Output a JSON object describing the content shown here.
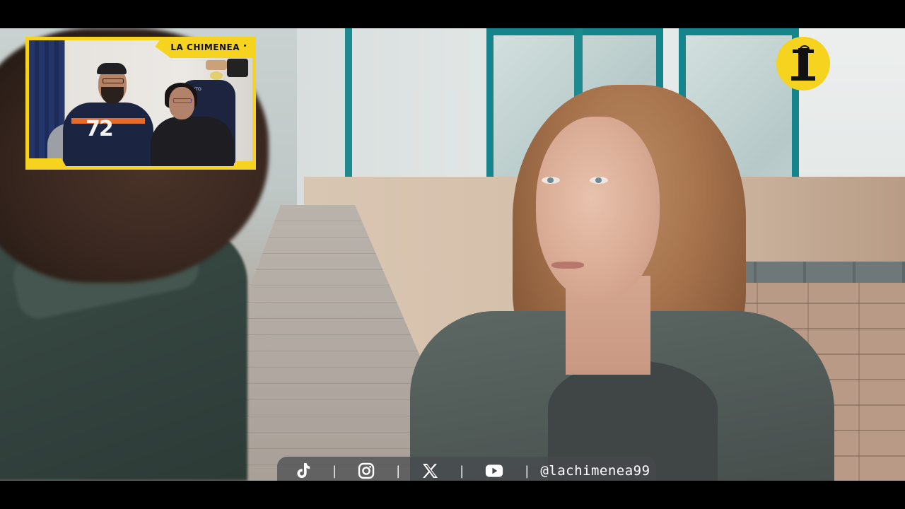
{
  "overlay": {
    "pip_label": "LA CHIMENEA",
    "jersey_number": "72",
    "chair_brand": "FERRITO"
  },
  "social": {
    "handle": "@lachimenea99",
    "icons": [
      "tiktok-icon",
      "instagram-icon",
      "x-icon",
      "youtube-icon"
    ]
  },
  "colors": {
    "accent_yellow": "#f5d31f",
    "bar_gray": "#464a4e"
  }
}
